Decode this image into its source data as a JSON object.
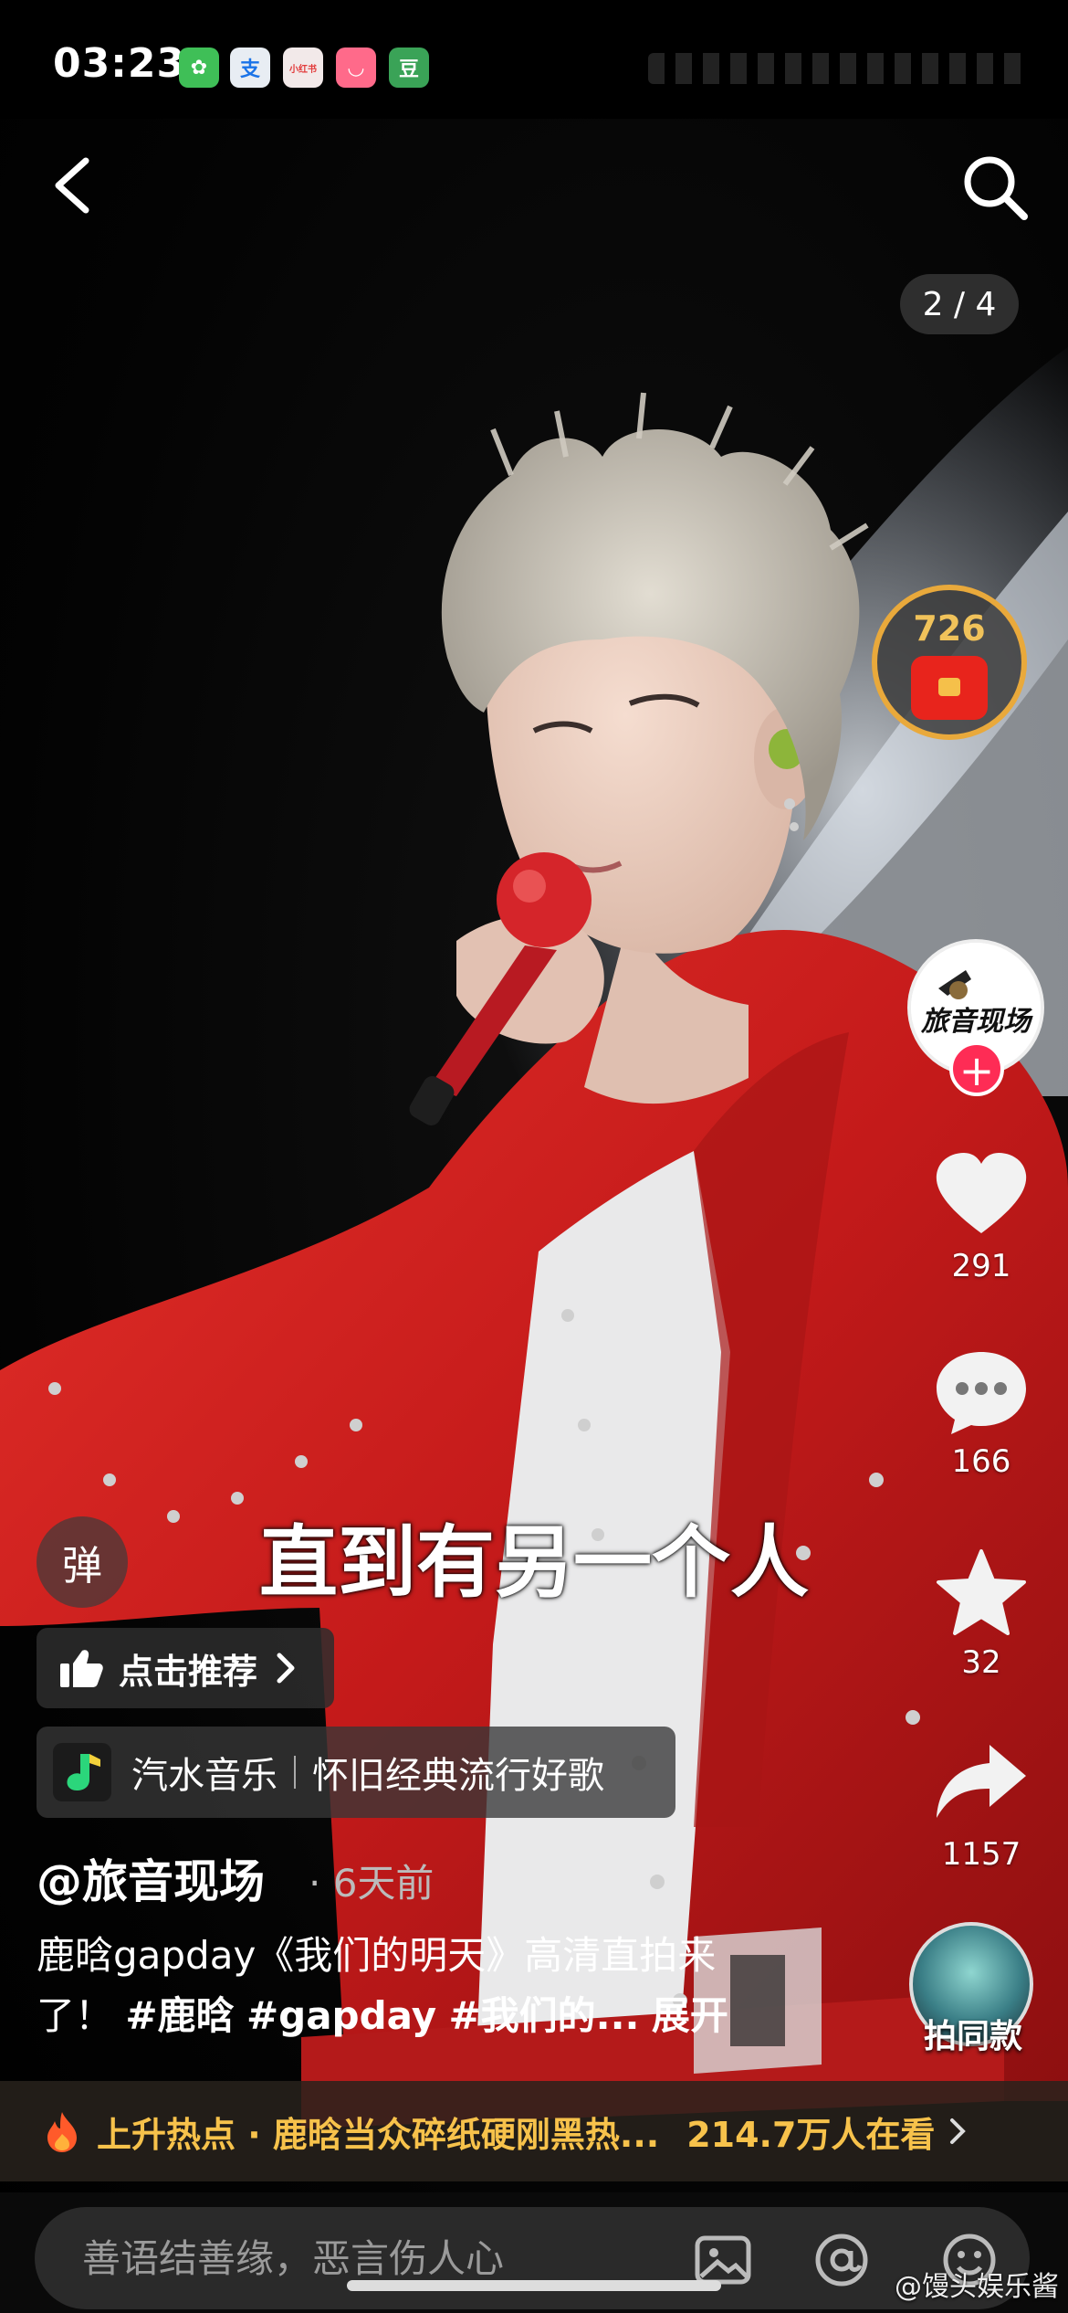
{
  "status_bar": {
    "time": "03:23",
    "notifications": [
      {
        "icon": "wechat-icon",
        "glyph": "✿",
        "bg": "#3fbf57"
      },
      {
        "icon": "alipay-icon",
        "glyph": "支",
        "bg": "#e8edf3"
      },
      {
        "icon": "xiaohongshu-icon",
        "glyph": "小红书",
        "bg": "#f2e9e9"
      },
      {
        "icon": "taobao-icon",
        "glyph": "◡",
        "bg": "#ff6a8a"
      },
      {
        "icon": "douban-icon",
        "glyph": "豆",
        "bg": "#3aa357"
      }
    ]
  },
  "nav": {
    "back_icon": "chevron-left-icon",
    "search_icon": "search-icon",
    "page_counter": "2 / 4"
  },
  "rail": {
    "redpacket_count": "726",
    "author_avatar_text": "旅音现场",
    "follow_glyph": "+",
    "likes": "291",
    "comments": "166",
    "favorites": "32",
    "shares": "1157",
    "same_style_label": "拍同款"
  },
  "overlay": {
    "danmaku_glyph": "弹",
    "subtitle": "直到有另一个人",
    "recommend_label": "点击推荐",
    "music_app": "汽水音乐",
    "music_playlist": "怀旧经典流行好歌"
  },
  "post": {
    "author_handle": "@旅音现场",
    "time_ago": "· 6天前",
    "caption_line1": "鹿晗gapday《我们的明天》高清直拍来",
    "caption_line2_prefix": "了！",
    "hashtags": [
      "#鹿晗",
      "#gapday",
      "#我们的..."
    ],
    "expand_label": "展开"
  },
  "hot_bar": {
    "text": "上升热点 · 鹿晗当众碎纸硬刚黑热...",
    "viewers": "214.7万人在看"
  },
  "comment_bar": {
    "placeholder": "善语结善缘，恶言伤人心",
    "image_icon": "image-icon",
    "mention_icon": "at-icon",
    "emoji_icon": "emoji-icon"
  },
  "watermark": "@馒头娱乐酱",
  "colors": {
    "accent_red": "#fe2c55",
    "hot_yellow": "#f7c24b",
    "jacket_red": "#d81f1f",
    "gold_ring": "#e9a93b"
  }
}
